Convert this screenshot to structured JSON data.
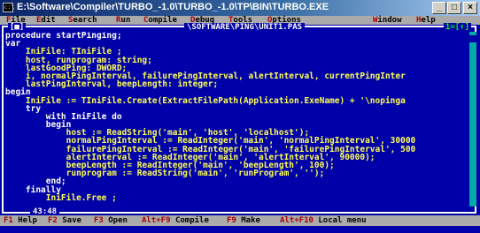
{
  "titlebar": {
    "icon_text": "ᴄ:\\",
    "title": "E:\\Software\\Compiler\\TURBO_-1.0\\TURBO_-1.0\\TP\\BIN\\TURBO.EXE",
    "minimize": "_",
    "maximize": "□",
    "close": "×"
  },
  "menu": [
    {
      "label": "File",
      "hot": "F",
      "rest": "ile"
    },
    {
      "label": "Edit",
      "hot": "E",
      "rest": "dit"
    },
    {
      "label": "Search",
      "hot": "S",
      "rest": "earch"
    },
    {
      "label": "Run",
      "hot": "R",
      "rest": "un"
    },
    {
      "label": "Compile",
      "hot": "C",
      "rest": "ompile"
    },
    {
      "label": "Debug",
      "hot": "D",
      "rest": "ebug"
    },
    {
      "label": "Tools",
      "hot": "T",
      "rest": "ools"
    },
    {
      "label": "Options",
      "hot": "O",
      "rest": "ptions"
    },
    {
      "label": "Window",
      "hot": "W",
      "rest": "indow"
    },
    {
      "label": "Help",
      "hot": "H",
      "rest": "elp"
    }
  ],
  "editor": {
    "close_box": "[■]",
    "file_title": "\\SOFTWARE\\PING\\UNIT1.PAS",
    "zoom_box": "1=[↑]",
    "cursor_pos": "43:48",
    "lines": [
      "procedure startPinging;",
      "var",
      "    IniFile: TIniFile ;",
      "    host, runprogram: string;",
      "    lastGoodPing: DWORD;",
      "    i, normalPingInterval, failurePingInterval, alertInterval, currentPingInter",
      "    lastPingInterval, beepLength: integer;",
      "begin",
      "    IniFile := TIniFile.Create(ExtractFilePath(Application.ExeName) + '\\nopinga",
      "    try",
      "        with IniFile do",
      "        begin",
      "            host := ReadString('main', 'host', 'localhost');",
      "            normalPingInterval := ReadInteger('main', 'normalPingInterval', 30000",
      "            failurePingInterval := ReadInteger('main', 'failurePingInterval', 500",
      "            alertInterval := ReadInteger('main', 'alertInterval', 90000);",
      "            beepLength := ReadInteger('main', 'beepLength', 100);",
      "            runprogram := ReadString('main', 'runProgram', '');",
      "        end;",
      "    finally",
      "        IniFile.Free ;"
    ]
  },
  "status": [
    {
      "key": "F1",
      "label": "Help"
    },
    {
      "key": "F2",
      "label": "Save"
    },
    {
      "key": "F3",
      "label": "Open"
    },
    {
      "key": "Alt+F9",
      "label": "Compile"
    },
    {
      "key": "F9",
      "label": "Make"
    },
    {
      "key": "Alt+F10",
      "label": "Local menu"
    }
  ]
}
